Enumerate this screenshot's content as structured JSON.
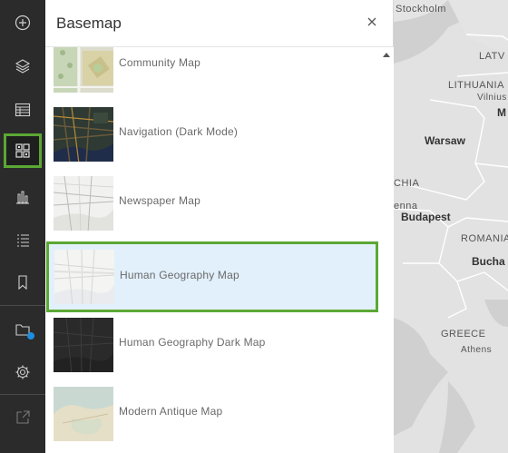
{
  "toolbar": {
    "tools": [
      {
        "icon": "add-icon"
      },
      {
        "icon": "layers-icon"
      },
      {
        "icon": "table-icon"
      },
      {
        "icon": "basemap-gallery-icon",
        "active": true
      },
      {
        "icon": "chart-icon"
      },
      {
        "icon": "legend-icon"
      },
      {
        "icon": "bookmark-icon"
      },
      {
        "icon": "map-properties-icon"
      },
      {
        "icon": "settings-icon"
      },
      {
        "icon": "share-icon"
      }
    ],
    "active_color": "#5ba834",
    "badge_color": "#1c8de0"
  },
  "panel": {
    "title": "Basemap",
    "close_icon": "close-icon"
  },
  "basemaps": [
    {
      "label": "Community Map"
    },
    {
      "label": "Navigation (Dark Mode)"
    },
    {
      "label": "Newspaper Map"
    },
    {
      "label": "Human Geography Map",
      "selected": true
    },
    {
      "label": "Human Geography Dark Map"
    },
    {
      "label": "Modern Antique Map"
    }
  ],
  "map": {
    "labels": {
      "stockholm": "Stockholm",
      "latvia": "LATV",
      "lithuania": "LITHUANIA",
      "vilnius": "Vilnius",
      "m": "M",
      "warsaw": "Warsaw",
      "chia": "CHIA",
      "enna": "enna",
      "budapest": "Budapest",
      "romania": "ROMANIA",
      "bucha": "Bucha",
      "greece": "GREECE",
      "athens": "Athens"
    }
  }
}
